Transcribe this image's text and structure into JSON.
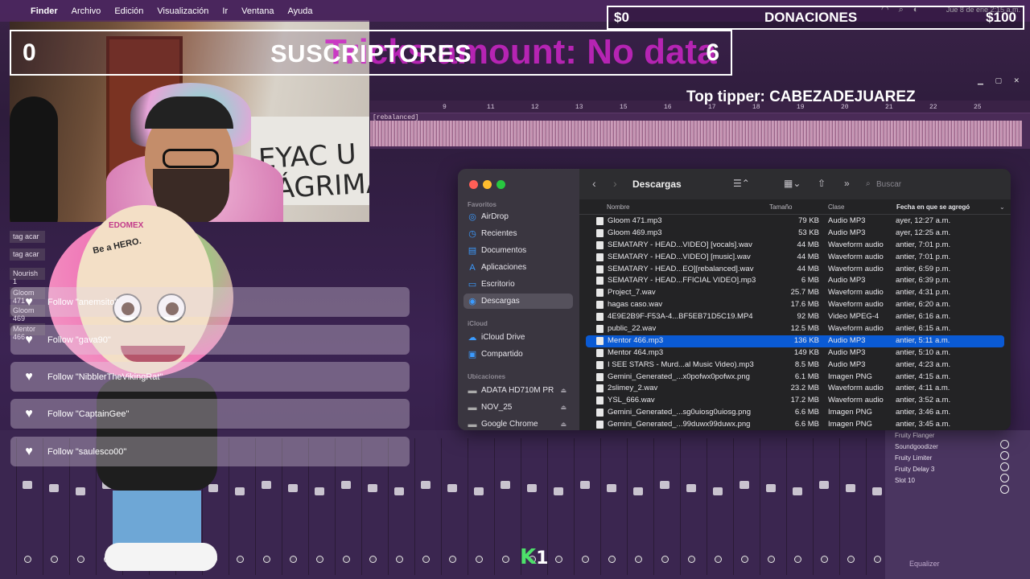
{
  "menubar": {
    "app": "Finder",
    "items": [
      "Archivo",
      "Edición",
      "Visualización",
      "Ir",
      "Ventana",
      "Ayuda"
    ],
    "datetime": "Jue 8 de ene 2:15 a.m."
  },
  "overlay": {
    "subs_count": "0",
    "subs_label": "SUSCRIPTORES",
    "subs_goal": "6",
    "tricks_text": "Tricks amount: No data",
    "donations_current": "$0",
    "donations_label": "DONACIONES",
    "donations_goal": "$100",
    "top_tipper": "Top tipper: CABEZADEJUAREZ"
  },
  "follows": [
    "Follow \"anemsito\"",
    "Follow \"gava90\"",
    "Follow \"NibblerTheVikingRat\"",
    "Follow \"CaptainGee\"",
    "Follow \"saulesco00\""
  ],
  "webcam": {
    "board_text": "EYAC U LÁGRIMA"
  },
  "mascot": {
    "logo": "EDOMEX",
    "tag": "Be a HERO."
  },
  "daw": {
    "clip_label": "[rebalanced]",
    "ruler": [
      "9",
      "11",
      "12",
      "13",
      "15",
      "16",
      "17",
      "18",
      "19",
      "20",
      "21",
      "22",
      "25"
    ],
    "track_labels": [
      "tag acar",
      "tag acar",
      "Nourish 1",
      "Gloom 471",
      "Gloom 469",
      "Mentor 466"
    ],
    "fx": [
      "Fruity Flanger",
      "Soundgoodizer",
      "Fruity Limiter",
      "Fruity Delay 3",
      "Slot 10"
    ],
    "fx_equalizer": "Equalizer",
    "k_label": "K",
    "k_num": "1"
  },
  "finder": {
    "title": "Descargas",
    "search_placeholder": "Buscar",
    "sidebar": {
      "favoritos_label": "Favoritos",
      "favoritos": [
        "AirDrop",
        "Recientes",
        "Documentos",
        "Aplicaciones",
        "Escritorio",
        "Descargas"
      ],
      "icloud_label": "iCloud",
      "icloud": [
        "iCloud Drive",
        "Compartido"
      ],
      "ubicaciones_label": "Ubicaciones",
      "ubicaciones": [
        "ADATA HD710M PR",
        "NOV_25",
        "Google Chrome"
      ]
    },
    "columns": {
      "name": "Nombre",
      "size": "Tamaño",
      "kind": "Clase",
      "date": "Fecha en que se agregó"
    },
    "files": [
      {
        "name": "Gloom 471.mp3",
        "size": "79 KB",
        "kind": "Audio MP3",
        "date": "ayer, 12:27 a.m."
      },
      {
        "name": "Gloom 469.mp3",
        "size": "53 KB",
        "kind": "Audio MP3",
        "date": "ayer, 12:25 a.m."
      },
      {
        "name": "SEMATARY - HEAD...VIDEO] [vocals].wav",
        "size": "44 MB",
        "kind": "Waveform audio",
        "date": "antier, 7:01 p.m."
      },
      {
        "name": "SEMATARY - HEAD...VIDEO] [music].wav",
        "size": "44 MB",
        "kind": "Waveform audio",
        "date": "antier, 7:01 p.m."
      },
      {
        "name": "SEMATARY - HEAD...EO][rebalanced].wav",
        "size": "44 MB",
        "kind": "Waveform audio",
        "date": "antier, 6:59 p.m."
      },
      {
        "name": "SEMATARY - HEAD...FFICIAL VIDEO].mp3",
        "size": "6 MB",
        "kind": "Audio MP3",
        "date": "antier, 6:39 p.m."
      },
      {
        "name": "Project_7.wav",
        "size": "25.7 MB",
        "kind": "Waveform audio",
        "date": "antier, 4:31 p.m."
      },
      {
        "name": "hagas caso.wav",
        "size": "17.6 MB",
        "kind": "Waveform audio",
        "date": "antier, 6:20 a.m."
      },
      {
        "name": "4E9E2B9F-F53A-4...BF5EB71D5C19.MP4",
        "size": "92 MB",
        "kind": "Video MPEG-4",
        "date": "antier, 6:16 a.m."
      },
      {
        "name": "public_22.wav",
        "size": "12.5 MB",
        "kind": "Waveform audio",
        "date": "antier, 6:15 a.m."
      },
      {
        "name": "Mentor 466.mp3",
        "size": "136 KB",
        "kind": "Audio MP3",
        "date": "antier, 5:11 a.m.",
        "selected": true
      },
      {
        "name": "Mentor 464.mp3",
        "size": "149 KB",
        "kind": "Audio MP3",
        "date": "antier, 5:10 a.m."
      },
      {
        "name": "I SEE STARS - Murd...al Music Video).mp3",
        "size": "8.5 MB",
        "kind": "Audio MP3",
        "date": "antier, 4:23 a.m."
      },
      {
        "name": "Gemini_Generated_...x0pofwx0pofwx.png",
        "size": "6.1 MB",
        "kind": "Imagen PNG",
        "date": "antier, 4:15 a.m."
      },
      {
        "name": "2slimey_2.wav",
        "size": "23.2 MB",
        "kind": "Waveform audio",
        "date": "antier, 4:11 a.m."
      },
      {
        "name": "YSL_666.wav",
        "size": "17.2 MB",
        "kind": "Waveform audio",
        "date": "antier, 3:52 a.m."
      },
      {
        "name": "Gemini_Generated_...sg0uiosg0uiosg.png",
        "size": "6.6 MB",
        "kind": "Imagen PNG",
        "date": "antier, 3:46 a.m."
      },
      {
        "name": "Gemini_Generated_...99duwx99duwx.png",
        "size": "6.6 MB",
        "kind": "Imagen PNG",
        "date": "antier, 3:45 a.m."
      }
    ]
  }
}
